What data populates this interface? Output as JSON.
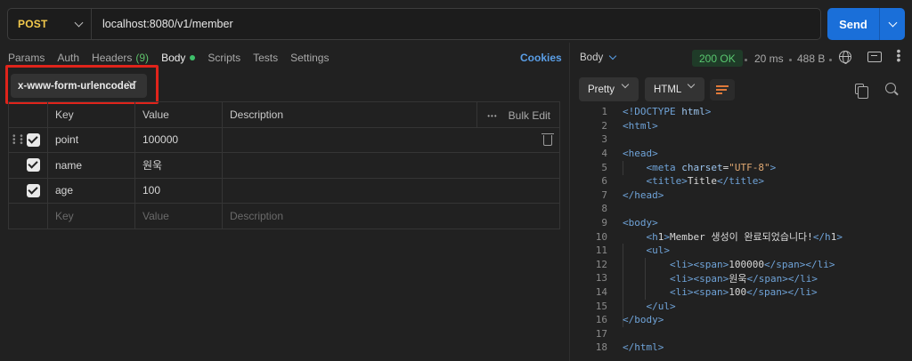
{
  "request": {
    "method": "POST",
    "url": "localhost:8080/v1/member",
    "send_label": "Send"
  },
  "tabs": [
    {
      "label": "Params",
      "active": false
    },
    {
      "label": "Auth",
      "active": false
    },
    {
      "label": "Headers",
      "count": "(9)",
      "active": false
    },
    {
      "label": "Body",
      "active": true
    },
    {
      "label": "Scripts",
      "active": false
    },
    {
      "label": "Tests",
      "active": false
    },
    {
      "label": "Settings",
      "active": false
    }
  ],
  "cookies_label": "Cookies",
  "body_type": "x-www-form-urlencoded",
  "table": {
    "headers": {
      "key": "Key",
      "value": "Value",
      "description": "Description"
    },
    "bulk_edit_label": "Bulk Edit",
    "more_label": "•••",
    "rows": [
      {
        "key": "point",
        "value": "100000",
        "description": ""
      },
      {
        "key": "name",
        "value": "원욱",
        "description": ""
      },
      {
        "key": "age",
        "value": "100",
        "description": ""
      }
    ],
    "placeholders": {
      "key": "Key",
      "value": "Value",
      "description": "Description"
    }
  },
  "response": {
    "view_label": "Body",
    "status": "200 OK",
    "time": "20 ms",
    "size": "488 B",
    "format": "Pretty",
    "language": "HTML",
    "code_lines": [
      "<!DOCTYPE html>",
      "<html>",
      "",
      "<head>",
      "    <meta charset=\"UTF-8\">",
      "    <title>Title</title>",
      "</head>",
      "",
      "<body>",
      "    <h1>Member 생성이 완료되었습니다!</h1>",
      "    <ul>",
      "        <li><span>100000</span></li>",
      "        <li><span>원욱</span></li>",
      "        <li><span>100</span></li>",
      "    </ul>",
      "</body>",
      "",
      "</html>"
    ]
  },
  "colors": {
    "method": "#f2c94c",
    "send": "#1a6fd9",
    "status": "#59c76f",
    "highlight": "#e0241b",
    "link": "#5a9ee6"
  }
}
